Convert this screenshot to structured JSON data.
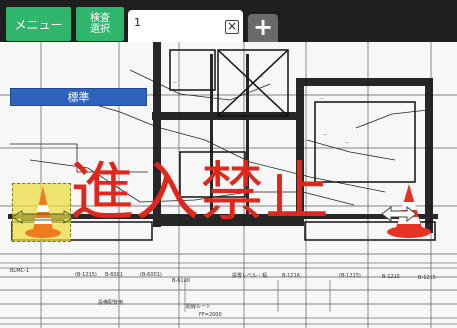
{
  "toolbar": {
    "menu_label": "メニュー",
    "inspection_select_line1": "検査",
    "inspection_select_line2": "選択",
    "tab_label": "1",
    "close_symbol": "×",
    "add_tab_symbol": "+"
  },
  "overlay": {
    "standard_label": "標準",
    "warning_text": "進入禁止"
  },
  "drawing_labels": {
    "left_1": "BLMC-1",
    "left_2": "(B-1215)",
    "left_3": "B-6001",
    "left_4": "(B-6001)",
    "left_5": "B-6100",
    "center_1": "設置レベル・幅",
    "right_1": "B-1216",
    "right_2": "(B-1215)",
    "right_3": "B-1215",
    "right_4": "B-1215",
    "bottom_1": "設備配管用",
    "bottom_2": "配線ルート",
    "bottom_3": "FF=2000"
  },
  "colors": {
    "toolbar": "#1f1f1f",
    "button_green": "#2fb56c",
    "tab_background": "#ffffff",
    "add_tab": "#6a6a6a",
    "chip_blue": "#2d63ba",
    "warning_red": "#e1261c",
    "cone_orange": "#f07a1e",
    "selection_yellow": "#ecdc3e"
  },
  "icons": {
    "close": "close-icon",
    "plus": "plus-icon",
    "left_cone": "traffic-cone-icon",
    "right_cone": "traffic-cone-icon",
    "left_arrow": "double-arrow-icon",
    "right_arrow": "double-arrow-icon"
  }
}
